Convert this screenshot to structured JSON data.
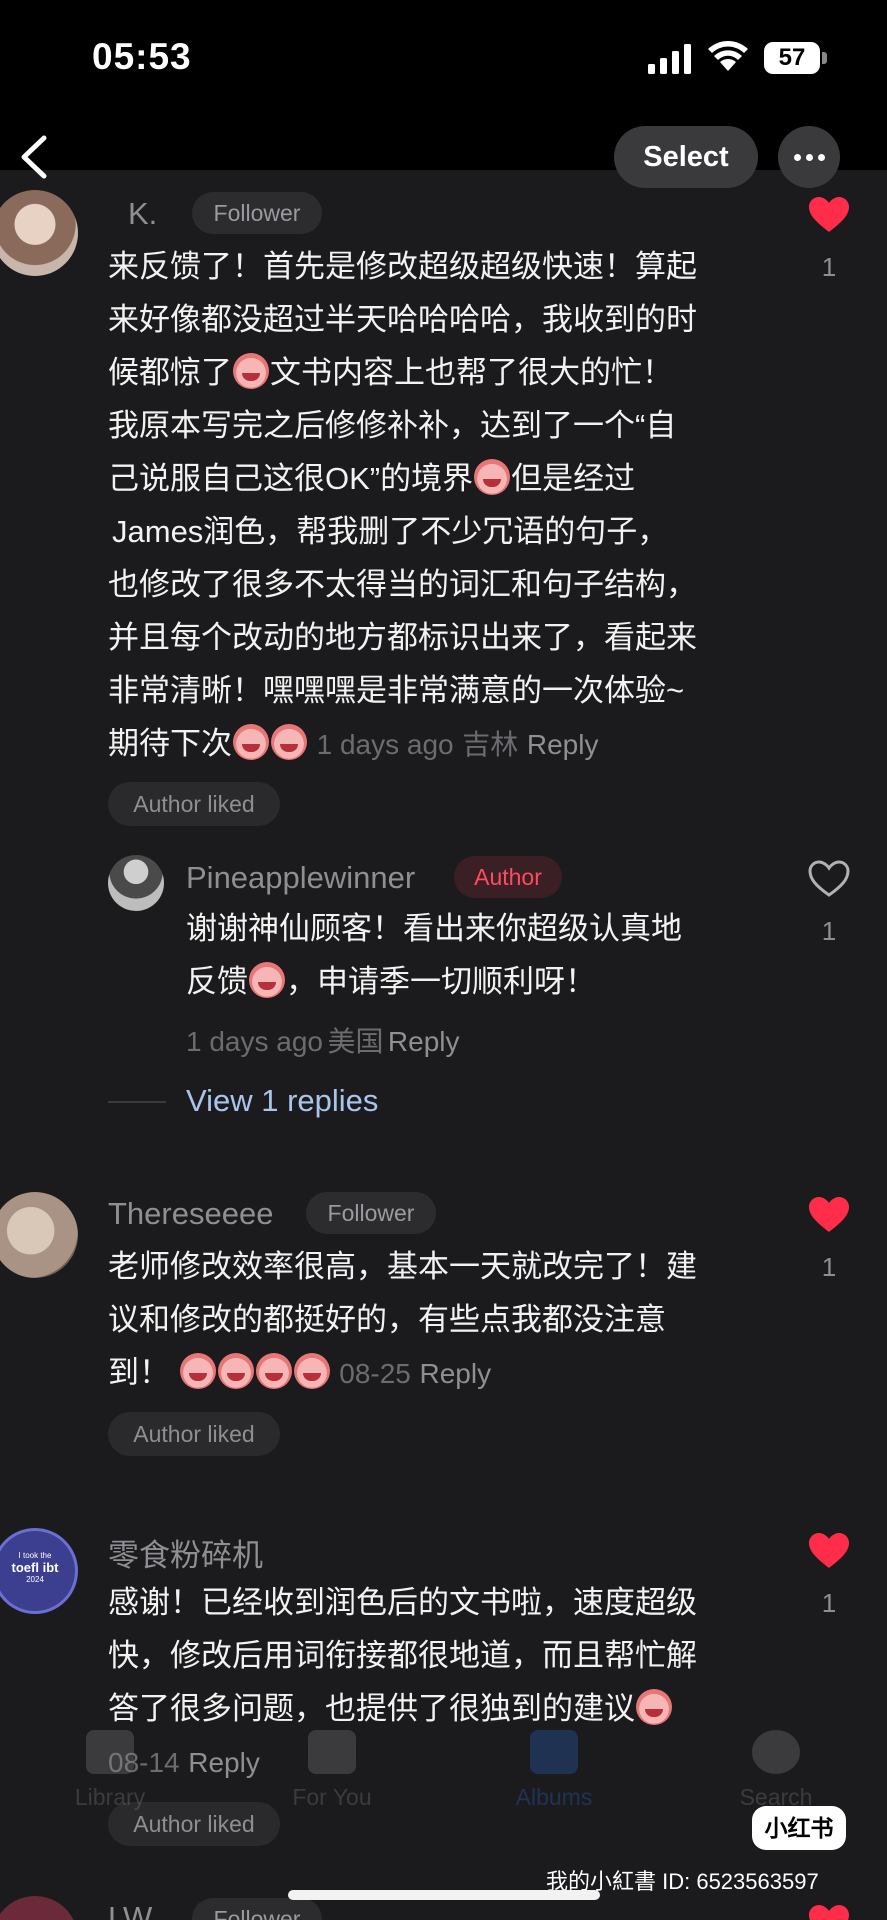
{
  "status": {
    "time": "05:53",
    "battery": "57"
  },
  "header": {
    "select_label": "Select"
  },
  "comments": [
    {
      "username": "K.",
      "tag": "Follower",
      "lines": [
        "来反馈了！首先是修改超级超级快速！算起",
        "来好像都没超过半天哈哈哈哈，我收到的时",
        "候都惊了",
        "文书内容上也帮了很大的忙！",
        "我原本写完之后修修补补，达到了一个“自",
        "己说服自己这很OK”的境界",
        "但是经过",
        "James润色，帮我删了不少冗语的句子，",
        "也修改了很多不太得当的词汇和句子结构，",
        "并且每个改动的地方都标识出来了，看起来",
        "非常清晰！嘿嘿嘿是非常满意的一次体验~",
        "期待下次"
      ],
      "time": "1 days ago",
      "location": "吉林",
      "reply_label": "Reply",
      "author_liked": "Author liked",
      "likes": "1",
      "liked": true,
      "reply": {
        "username": "Pineapplewinner",
        "tag": "Author",
        "lines": [
          "谢谢神仙顾客！看出来你超级认真地",
          "反馈",
          "，申请季一切顺利呀！"
        ],
        "time": "1 days ago",
        "location": "美国",
        "reply_label": "Reply",
        "likes": "1",
        "liked": false
      },
      "view_replies": "View 1 replies"
    },
    {
      "username": "Thereseeee",
      "tag": "Follower",
      "lines": [
        "老师修改效率很高，基本一天就改完了！建",
        "议和修改的都挺好的，有些点我都没注意",
        "到！"
      ],
      "time": "08-25",
      "reply_label": "Reply",
      "author_liked": "Author liked",
      "likes": "1",
      "liked": true
    },
    {
      "username": "零食粉碎机",
      "avatar_text": "I took the",
      "avatar_brand": "toefl ibt",
      "avatar_year": "2024",
      "lines": [
        "感谢！已经收到润色后的文书啦，速度超级",
        "快，修改后用词衔接都很地道，而且帮忙解",
        "答了很多问题，也提供了很独到的建议"
      ],
      "time": "08-14",
      "reply_label": "Reply",
      "author_liked": "Author liked",
      "likes": "1",
      "liked": true
    },
    {
      "username": "LW",
      "tag": "Follower"
    }
  ],
  "tabbar": {
    "items": [
      "Library",
      "For You",
      "Albums",
      "Search"
    ]
  },
  "watermark": {
    "logo": "小红书",
    "id_line": "我的小紅書 ID: 6523563597"
  },
  "colors": {
    "like_red": "#ff2d4a",
    "author_red": "#ff4a60",
    "link_blue": "#a9c5ec",
    "background": "#1b1b1d"
  }
}
